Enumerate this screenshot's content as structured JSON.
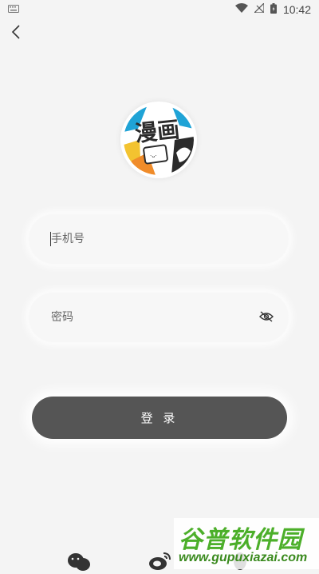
{
  "status_bar": {
    "time": "10:42",
    "icons": [
      "keyboard-icon",
      "wifi-icon",
      "no-signal-icon",
      "battery-icon"
    ]
  },
  "nav": {
    "back_icon": "chevron-left-icon"
  },
  "logo": {
    "text": "漫画",
    "colors": {
      "blue": "#1fa3d6",
      "orange": "#f08c2a",
      "yellow": "#f3c330",
      "dark": "#2b2b2b"
    }
  },
  "form": {
    "phone": {
      "placeholder": "手机号",
      "value": ""
    },
    "password": {
      "placeholder": "密码",
      "value": "",
      "toggle_icon": "eye-off-icon"
    },
    "login_label": "登 录"
  },
  "social_login": {
    "icons": [
      "wechat-icon",
      "weibo-icon",
      "qq-icon"
    ]
  },
  "watermark": {
    "title": "谷普软件园",
    "url": "www.gupuxiazai.com"
  },
  "theme": {
    "background": "#f4f4f4",
    "button": "#555555",
    "watermark_green": "#4caf2a"
  }
}
